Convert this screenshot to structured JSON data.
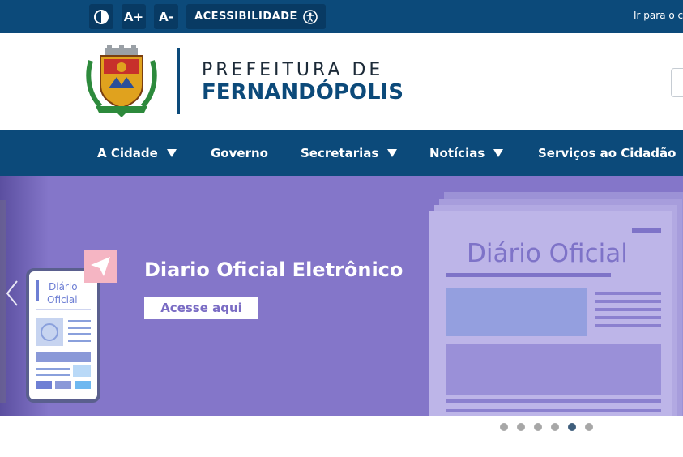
{
  "accessibility_bar": {
    "contrast_icon": "contrast-icon",
    "increase_font_label": "A+",
    "decrease_font_label": "A-",
    "accessibility_label": "ACESSIBILIDADE",
    "accessibility_icon": "accessibility-icon",
    "skip_link_label": "Ir para o c"
  },
  "header": {
    "title_line1": "PREFEITURA DE",
    "title_line2": "FERNANDÓPOLIS",
    "crest_icon": "municipal-crest-icon"
  },
  "nav": {
    "items": [
      {
        "label": "A Cidade",
        "has_dropdown": true
      },
      {
        "label": "Governo",
        "has_dropdown": false
      },
      {
        "label": "Secretarias",
        "has_dropdown": true
      },
      {
        "label": "Notícias",
        "has_dropdown": true
      },
      {
        "label": "Serviços ao Cidadão",
        "has_dropdown": false
      }
    ]
  },
  "banner": {
    "title": "Diario Oficial Eletrônico",
    "button_label": "Acesse aqui",
    "phone_text_line1": "Diário",
    "phone_text_line2": "Oficial",
    "paper_title": "Diário Oficial",
    "background_color": "#8476c9"
  },
  "carousel": {
    "slide_count": 6,
    "active_index": 4
  },
  "colors": {
    "brand_blue": "#0c4a7a",
    "banner_purple": "#8476c9"
  }
}
